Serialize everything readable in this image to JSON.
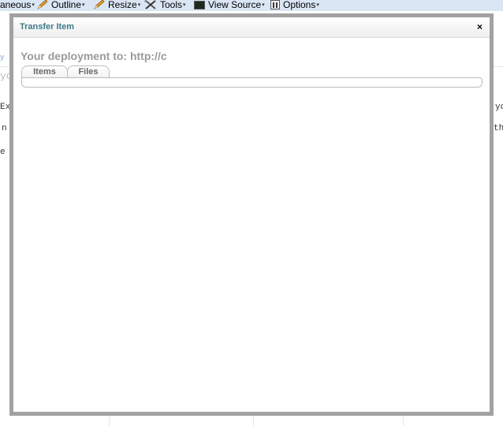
{
  "toolbar": {
    "items": [
      {
        "label": "aneous",
        "icon": "none"
      },
      {
        "label": "Outline",
        "icon": "pencil-icon"
      },
      {
        "label": "Resize",
        "icon": "pencil-icon"
      },
      {
        "label": "Tools",
        "icon": "tools-icon"
      },
      {
        "label": "View Source",
        "icon": "monitor-icon"
      },
      {
        "label": "Options",
        "icon": "options-icon"
      }
    ],
    "caret": "▾"
  },
  "background": {
    "snippet_a": "y",
    "snippet_b": "yo",
    "snippet_c": "Ex",
    "snippet_d": "n",
    "snippet_e": "e",
    "snippet_f": "yo",
    "snippet_g": "the"
  },
  "modal": {
    "title": "Transfer Item",
    "close_glyph": "×",
    "heading": "Your deployment to: http://c",
    "tabs": [
      {
        "label": "Items"
      },
      {
        "label": "Files"
      }
    ]
  },
  "colors": {
    "toolbar_bg": "#dbe6f4",
    "title": "#3d7a8a",
    "frame": "#a2a2a2",
    "heading": "#9a9a9a"
  }
}
